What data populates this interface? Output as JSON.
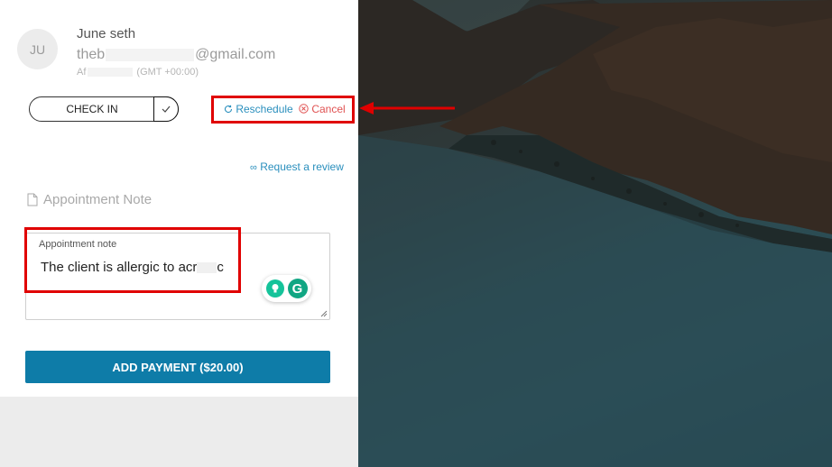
{
  "client": {
    "initials": "JU",
    "name": "June seth",
    "email_prefix": "theb",
    "email_suffix": "@gmail.com",
    "phone_prefix": "Af",
    "timezone": "(GMT +00:00)"
  },
  "actions": {
    "checkin_label": "CHECK IN",
    "checkin_icon": "check-icon",
    "reschedule_label": "Reschedule",
    "cancel_label": "Cancel",
    "review_label": "Request a review"
  },
  "note": {
    "section_title": "Appointment Note",
    "field_label": "Appointment note",
    "field_value": "The client is allergic to acr",
    "field_value_tail": "c"
  },
  "payment": {
    "button_label": "ADD PAYMENT ($20.00)"
  },
  "colors": {
    "accent": "#0e7ca8",
    "link": "#2a8fbd",
    "danger": "#e05252",
    "annotation": "#e00000"
  }
}
